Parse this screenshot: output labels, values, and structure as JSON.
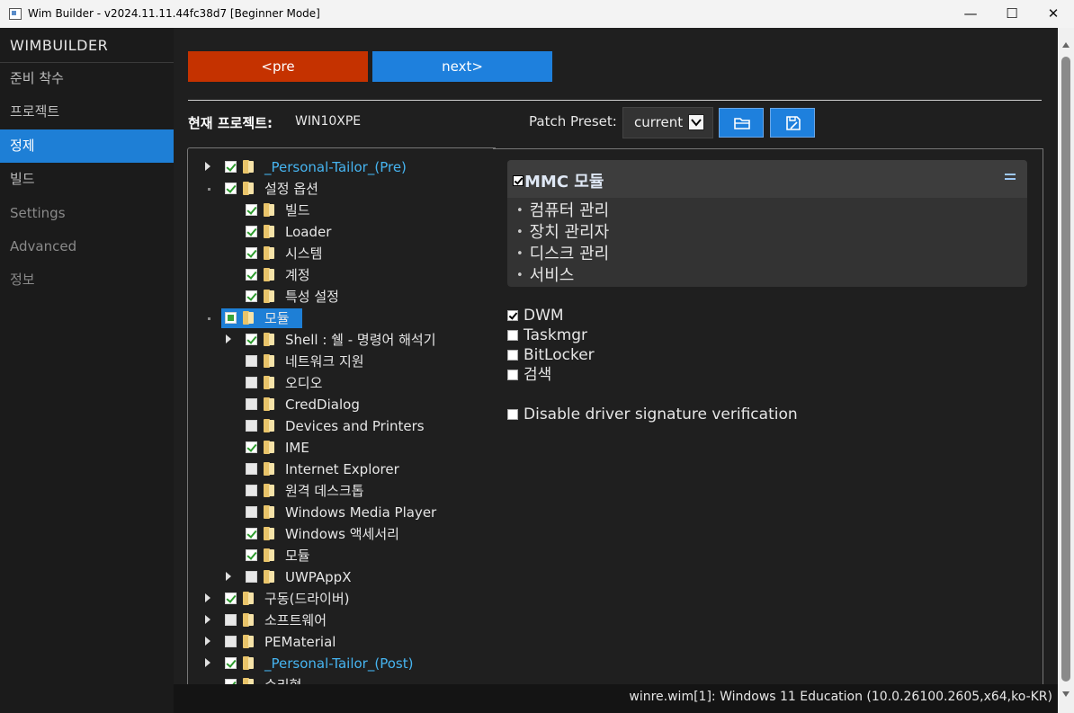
{
  "window": {
    "title": "Wim Builder - v2024.11.11.44fc38d7 [Beginner Mode]",
    "minimize": "—",
    "maximize": "☐",
    "close": "✕"
  },
  "sidebar": {
    "header": "WIMBUILDER",
    "items": [
      {
        "label": "준비 착수"
      },
      {
        "label": "프로젝트"
      },
      {
        "label": "정제"
      },
      {
        "label": "빌드"
      },
      {
        "label": "Settings"
      },
      {
        "label": "Advanced"
      },
      {
        "label": "정보"
      }
    ],
    "active_index": 2
  },
  "nav": {
    "pre_label": "<pre",
    "next_label": "next>"
  },
  "project": {
    "label": "현재 프로젝트:",
    "value": "WIN10XPE"
  },
  "preset": {
    "label": "Patch Preset:",
    "value": "current",
    "open_icon": "folder-open-icon",
    "save_icon": "save-icon"
  },
  "tree": [
    {
      "label": "_Personal-Tailor_(Pre)",
      "level": 0,
      "checked": "on",
      "expander": "closed",
      "link": true
    },
    {
      "label": "설정 옵션",
      "level": 0,
      "checked": "on",
      "expander": "open"
    },
    {
      "label": "빌드",
      "level": 1,
      "checked": "on",
      "expander": "none"
    },
    {
      "label": "Loader",
      "level": 1,
      "checked": "on",
      "expander": "none"
    },
    {
      "label": "시스템",
      "level": 1,
      "checked": "on",
      "expander": "none"
    },
    {
      "label": "계정",
      "level": 1,
      "checked": "on",
      "expander": "none"
    },
    {
      "label": "특성 설정",
      "level": 1,
      "checked": "on",
      "expander": "none"
    },
    {
      "label": "모듈",
      "level": 0,
      "checked": "partial",
      "expander": "open",
      "selected": true
    },
    {
      "label": "Shell : 쉘 - 명령어 해석기",
      "level": 1,
      "checked": "on",
      "expander": "closed"
    },
    {
      "label": "네트워크 지원",
      "level": 1,
      "checked": "off",
      "expander": "none"
    },
    {
      "label": "오디오",
      "level": 1,
      "checked": "off",
      "expander": "none"
    },
    {
      "label": "CredDialog",
      "level": 1,
      "checked": "off",
      "expander": "none"
    },
    {
      "label": "Devices and Printers",
      "level": 1,
      "checked": "off",
      "expander": "none"
    },
    {
      "label": "IME",
      "level": 1,
      "checked": "on",
      "expander": "none"
    },
    {
      "label": "Internet Explorer",
      "level": 1,
      "checked": "off",
      "expander": "none"
    },
    {
      "label": "원격 데스크톱",
      "level": 1,
      "checked": "off",
      "expander": "none"
    },
    {
      "label": "Windows Media Player",
      "level": 1,
      "checked": "off",
      "expander": "none"
    },
    {
      "label": "Windows 액세서리",
      "level": 1,
      "checked": "on",
      "expander": "none"
    },
    {
      "label": "모듈",
      "level": 1,
      "checked": "on",
      "expander": "none"
    },
    {
      "label": "UWPAppX",
      "level": 1,
      "checked": "off",
      "expander": "closed"
    },
    {
      "label": "구동(드라이버)",
      "level": 0,
      "checked": "on",
      "expander": "closed"
    },
    {
      "label": "소프트웨어",
      "level": 0,
      "checked": "off",
      "expander": "closed"
    },
    {
      "label": "PEMaterial",
      "level": 0,
      "checked": "off",
      "expander": "closed"
    },
    {
      "label": "_Personal-Tailor_(Post)",
      "level": 0,
      "checked": "on",
      "expander": "closed",
      "link": true
    },
    {
      "label": "수리형",
      "level": 0,
      "checked": "on",
      "expander": "none"
    }
  ],
  "card": {
    "title": "MMC 모듈",
    "checked": true,
    "menu_icon": "menu-icon",
    "items": [
      "컴퓨터 관리",
      "장치 관리자",
      "디스크 관리",
      "서비스"
    ]
  },
  "options": [
    {
      "label": "DWM",
      "checked": true
    },
    {
      "label": "Taskmgr",
      "checked": false
    },
    {
      "label": "BitLocker",
      "checked": false
    },
    {
      "label": "검색",
      "checked": false
    },
    {
      "label": "Disable driver signature verification",
      "checked": false
    }
  ],
  "status": {
    "text": "winre.wim[1]: Windows 11 Education (10.0.26100.2605,x64,ko-KR)"
  }
}
